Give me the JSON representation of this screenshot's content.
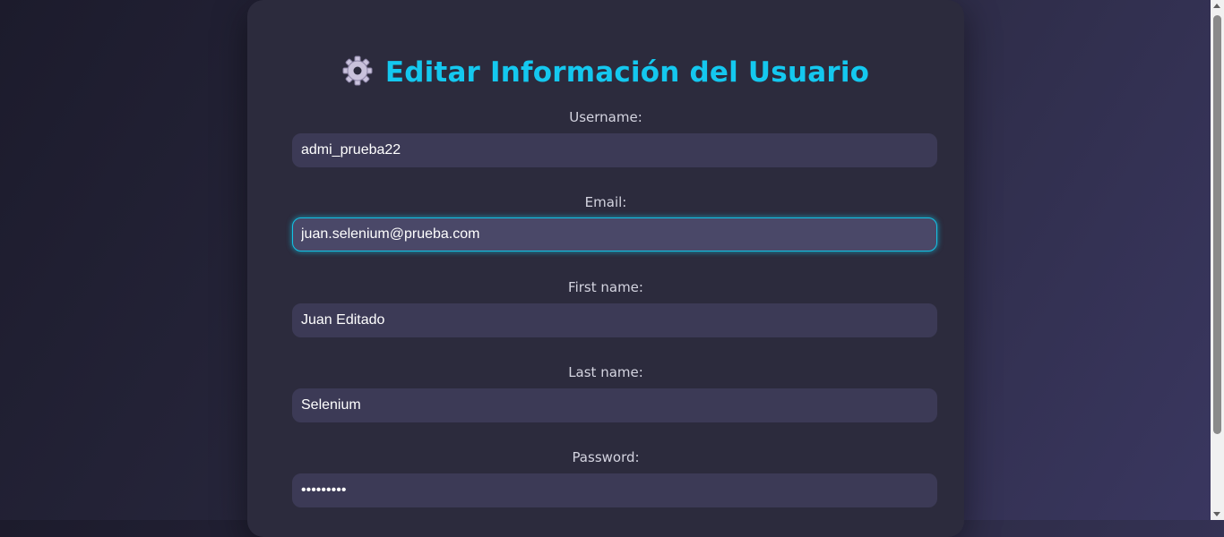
{
  "form": {
    "title": "Editar Información del Usuario",
    "title_icon": "gear-icon",
    "accent_color": "#14c8ef",
    "fields": {
      "username": {
        "label": "Username:",
        "value": "admi_prueba22"
      },
      "email": {
        "label": "Email:",
        "value": "juan.selenium@prueba.com"
      },
      "first_name": {
        "label": "First name:",
        "value": "Juan Editado"
      },
      "last_name": {
        "label": "Last name:",
        "value": "Selenium"
      },
      "password": {
        "label": "Password:",
        "value": "pruebaSel"
      }
    }
  }
}
